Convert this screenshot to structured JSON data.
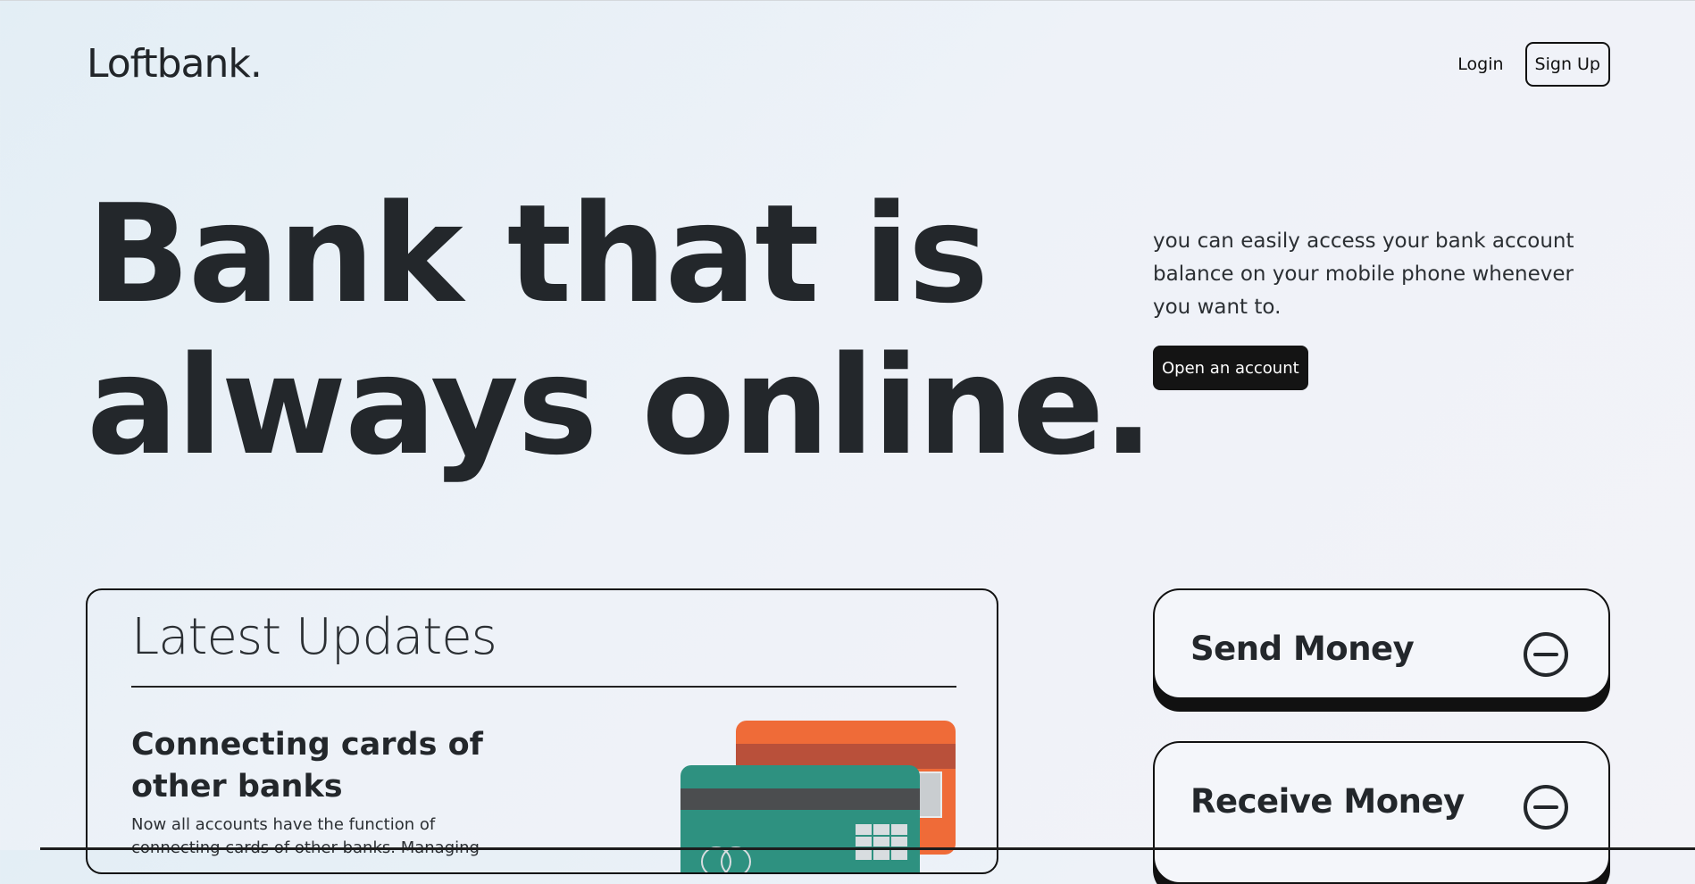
{
  "header": {
    "logo": "Loftbank.",
    "login_label": "Login",
    "signup_label": "Sign Up"
  },
  "hero": {
    "title_line1": "Bank that is",
    "title_line2": "always online.",
    "description": "you can easily access your bank account balance on your mobile phone whenever you want to.",
    "cta_label": "Open an account"
  },
  "updates": {
    "heading": "Latest Updates",
    "item": {
      "title": "Connecting cards of other banks",
      "text": "Now all accounts have the function of connecting cards of other banks. Managing"
    }
  },
  "actions": {
    "send_label": "Send Money",
    "receive_label": "Receive Money",
    "icon": "minus-circle-icon"
  },
  "colors": {
    "text": "#212529",
    "dark_button": "#141414",
    "card_orange": "#ef6b38",
    "card_teal": "#2e9180"
  }
}
